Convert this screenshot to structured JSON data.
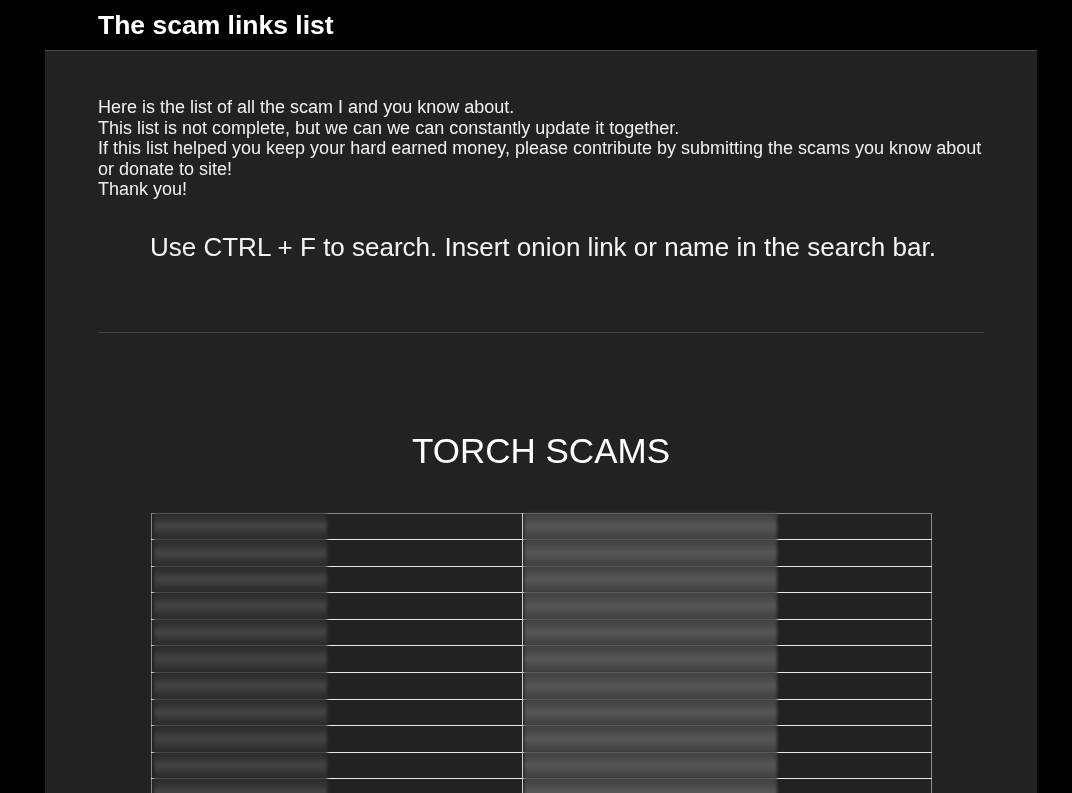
{
  "header": {
    "title": "The scam links list"
  },
  "intro": {
    "lines": [
      "Here is the list of all the scam I and you know about.",
      "This list is not complete, but we can we can constantly update it together.",
      "If this list helped you keep your hard earned money, please contribute by submitting the scams you know about or donate to site!",
      "Thank you!"
    ]
  },
  "search_hint": "Use CTRL + F to search. Insert onion link or name in the search bar.",
  "section": {
    "title": "TORCH SCAMS"
  },
  "table": {
    "rows": [
      {
        "cells": [
          {
            "redacted": true
          },
          {
            "redacted": true
          }
        ]
      },
      {
        "cells": [
          {
            "redacted": true
          },
          {
            "redacted": true
          }
        ]
      },
      {
        "cells": [
          {
            "redacted": true
          },
          {
            "redacted": true
          }
        ]
      },
      {
        "cells": [
          {
            "redacted": true
          },
          {
            "redacted": true
          }
        ]
      },
      {
        "cells": [
          {
            "redacted": true
          },
          {
            "redacted": true
          }
        ]
      },
      {
        "cells": [
          {
            "redacted": true
          },
          {
            "redacted": true
          }
        ]
      },
      {
        "cells": [
          {
            "redacted": true
          },
          {
            "redacted": true
          }
        ]
      },
      {
        "cells": [
          {
            "redacted": true
          },
          {
            "redacted": true
          }
        ]
      },
      {
        "cells": [
          {
            "redacted": true
          },
          {
            "redacted": true
          }
        ]
      },
      {
        "cells": [
          {
            "redacted": true
          },
          {
            "redacted": true
          }
        ]
      },
      {
        "cells": [
          {
            "redacted": true
          },
          {
            "redacted": true
          }
        ]
      }
    ]
  }
}
